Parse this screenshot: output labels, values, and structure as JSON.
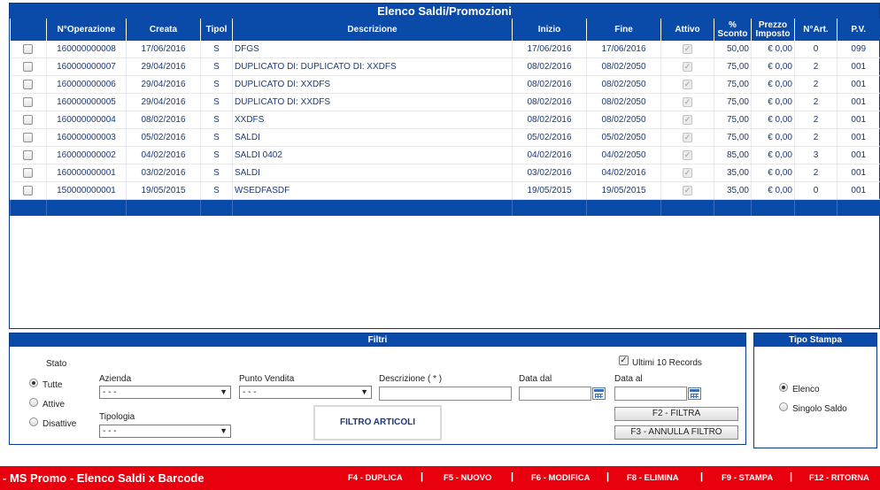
{
  "list": {
    "title": "Elenco Saldi/Promozioni",
    "columns": {
      "num_operazione": "N°Operazione",
      "creata": "Creata",
      "tipol": "Tipol",
      "descrizione": "Descrizione",
      "inizio": "Inizio",
      "fine": "Fine",
      "attivo": "Attivo",
      "sconto_1": "%",
      "sconto_2": "Sconto",
      "prezzo_1": "Prezzo",
      "prezzo_2": "Imposto",
      "nart": "N°Art.",
      "pv": "P.V."
    },
    "rows": [
      {
        "num": "160000000008",
        "creata": "17/06/2016",
        "tipol": "S",
        "descr": "DFGS",
        "inizio": "17/06/2016",
        "fine": "17/06/2016",
        "sconto": "50,00",
        "prezzo": "€ 0,00",
        "nart": "0",
        "pv": "099"
      },
      {
        "num": "160000000007",
        "creata": "29/04/2016",
        "tipol": "S",
        "descr": "DUPLICATO DI: DUPLICATO DI: XXDFS",
        "inizio": "08/02/2016",
        "fine": "08/02/2050",
        "sconto": "75,00",
        "prezzo": "€ 0,00",
        "nart": "2",
        "pv": "001"
      },
      {
        "num": "160000000006",
        "creata": "29/04/2016",
        "tipol": "S",
        "descr": "DUPLICATO DI: XXDFS",
        "inizio": "08/02/2016",
        "fine": "08/02/2050",
        "sconto": "75,00",
        "prezzo": "€ 0,00",
        "nart": "2",
        "pv": "001"
      },
      {
        "num": "160000000005",
        "creata": "29/04/2016",
        "tipol": "S",
        "descr": "DUPLICATO DI: XXDFS",
        "inizio": "08/02/2016",
        "fine": "08/02/2050",
        "sconto": "75,00",
        "prezzo": "€ 0,00",
        "nart": "2",
        "pv": "001"
      },
      {
        "num": "160000000004",
        "creata": "08/02/2016",
        "tipol": "S",
        "descr": "XXDFS",
        "inizio": "08/02/2016",
        "fine": "08/02/2050",
        "sconto": "75,00",
        "prezzo": "€ 0,00",
        "nart": "2",
        "pv": "001"
      },
      {
        "num": "160000000003",
        "creata": "05/02/2016",
        "tipol": "S",
        "descr": "SALDI",
        "inizio": "05/02/2016",
        "fine": "05/02/2050",
        "sconto": "75,00",
        "prezzo": "€ 0,00",
        "nart": "2",
        "pv": "001"
      },
      {
        "num": "160000000002",
        "creata": "04/02/2016",
        "tipol": "S",
        "descr": "SALDI 0402",
        "inizio": "04/02/2016",
        "fine": "04/02/2050",
        "sconto": "85,00",
        "prezzo": "€ 0,00",
        "nart": "3",
        "pv": "001"
      },
      {
        "num": "160000000001",
        "creata": "03/02/2016",
        "tipol": "S",
        "descr": "SALDI",
        "inizio": "03/02/2016",
        "fine": "04/02/2016",
        "sconto": "35,00",
        "prezzo": "€ 0,00",
        "nart": "2",
        "pv": "001"
      },
      {
        "num": "150000000001",
        "creata": "19/05/2015",
        "tipol": "S",
        "descr": "WSEDFASDF",
        "inizio": "19/05/2015",
        "fine": "19/05/2015",
        "sconto": "35,00",
        "prezzo": "€ 0,00",
        "nart": "0",
        "pv": "001"
      }
    ]
  },
  "filters": {
    "title": "Filtri",
    "stato_label": "Stato",
    "stato_options": {
      "tutte": "Tutte",
      "attive": "Attive",
      "disattive": "Disattive"
    },
    "azienda_label": "Azienda",
    "azienda_value": "- - -",
    "punto_vendita_label": "Punto Vendita",
    "punto_vendita_value": "- - -",
    "descrizione_label": "Descrizione ( * )",
    "data_dal_label": "Data dal",
    "data_al_label": "Data al",
    "tipologia_label": "Tipologia",
    "tipologia_value": "- - -",
    "ultimi_label": "Ultimi 10 Records",
    "filtra_button": "F2 - FILTRA",
    "annulla_button": "F3 - ANNULLA FILTRO",
    "filtro_articoli": "FILTRO ARTICOLI"
  },
  "tipo_stampa": {
    "title": "Tipo Stampa",
    "elenco": "Elenco",
    "singolo": "Singolo Saldo"
  },
  "bottom_bar": {
    "app_title": "- MS Promo - Elenco Saldi x Barcode",
    "f4": "F4 - DUPLICA",
    "f5": "F5 - NUOVO",
    "f6": "F6 - MODIFICA",
    "f8": "F8 - ELIMINA",
    "f9": "F9 - STAMPA",
    "f12": "F12 - RITORNA",
    "separator": "|"
  },
  "colors": {
    "header_blue": "#0a4aa8",
    "bottom_red": "#e8000e"
  }
}
